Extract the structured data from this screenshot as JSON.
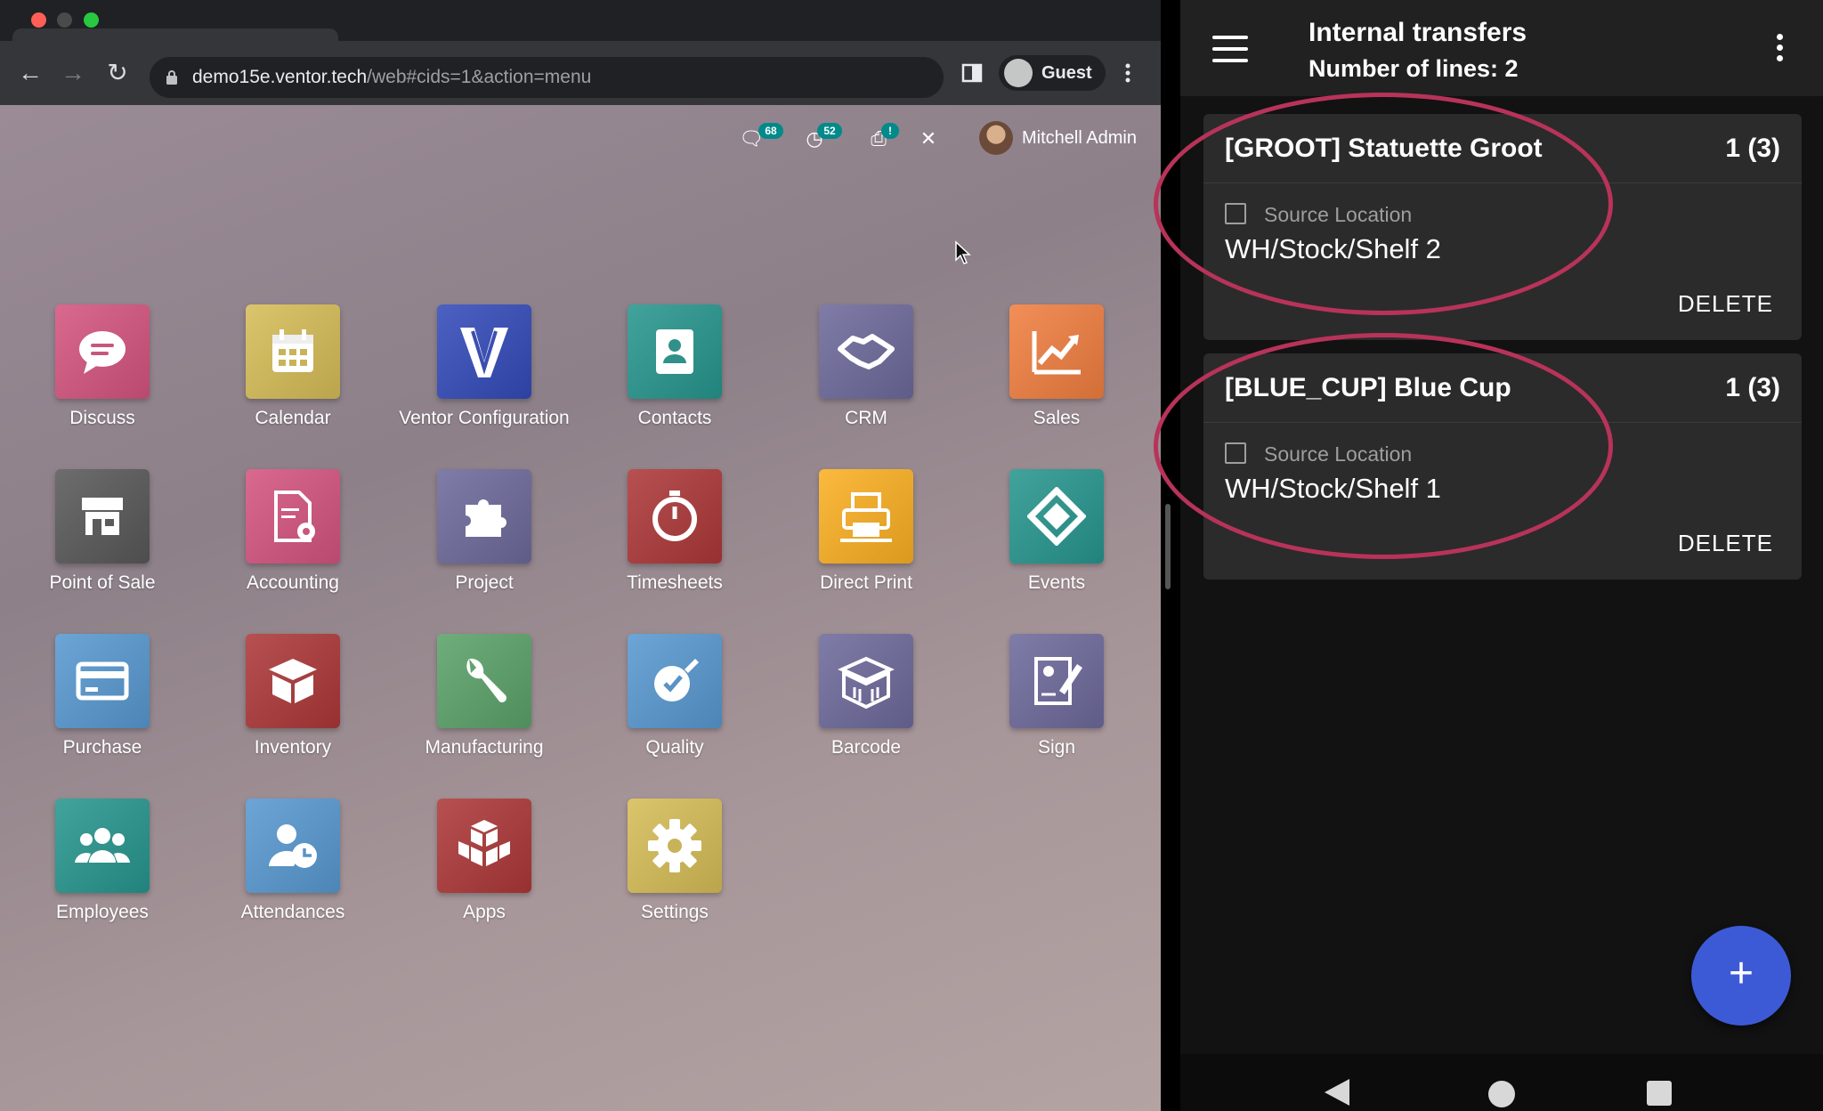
{
  "browser": {
    "url_host": "demo15e.ventor.tech",
    "url_path": "/web#cids=1&action=menu",
    "profile_label": "Guest"
  },
  "odoo": {
    "systray": {
      "messages_count": "68",
      "activities_count": "52",
      "print_badge": "!"
    },
    "user_name": "Mitchell Admin",
    "apps": [
      {
        "label": "Discuss",
        "icon": "chat-icon",
        "color": "#c7577c"
      },
      {
        "label": "Calendar",
        "icon": "calendar-icon",
        "color": "#c9b35a"
      },
      {
        "label": "Ventor Configuration",
        "icon": "ventor-logo-icon",
        "color": "#3b4fb0"
      },
      {
        "label": "Contacts",
        "icon": "contact-card-icon",
        "color": "#2f9189"
      },
      {
        "label": "CRM",
        "icon": "handshake-icon",
        "color": "#6e6a96"
      },
      {
        "label": "Sales",
        "icon": "trend-chart-icon",
        "color": "#e07c45"
      },
      {
        "label": "Point of Sale",
        "icon": "shop-icon",
        "color": "#5b5b5b"
      },
      {
        "label": "Accounting",
        "icon": "invoice-gear-icon",
        "color": "#c7577c"
      },
      {
        "label": "Project",
        "icon": "puzzle-icon",
        "color": "#6e6a96"
      },
      {
        "label": "Timesheets",
        "icon": "stopwatch-icon",
        "color": "#a53f3f"
      },
      {
        "label": "Direct Print",
        "icon": "printer-icon",
        "color": "#e9a72c"
      },
      {
        "label": "Events",
        "icon": "ticket-icon",
        "color": "#2f9189"
      },
      {
        "label": "Purchase",
        "icon": "credit-card-icon",
        "color": "#5a93c4"
      },
      {
        "label": "Inventory",
        "icon": "box-icon",
        "color": "#a53f3f"
      },
      {
        "label": "Manufacturing",
        "icon": "wrench-icon",
        "color": "#5d9c6a"
      },
      {
        "label": "Quality",
        "icon": "quality-badge-icon",
        "color": "#5a93c4"
      },
      {
        "label": "Barcode",
        "icon": "barcode-box-icon",
        "color": "#6e6a96"
      },
      {
        "label": "Sign",
        "icon": "sign-document-icon",
        "color": "#6e6a96"
      },
      {
        "label": "Employees",
        "icon": "people-icon",
        "color": "#2f9189"
      },
      {
        "label": "Attendances",
        "icon": "user-clock-icon",
        "color": "#5a93c4"
      },
      {
        "label": "Apps",
        "icon": "cubes-icon",
        "color": "#a53f3f"
      },
      {
        "label": "Settings",
        "icon": "gear-icon",
        "color": "#c9b35a"
      }
    ]
  },
  "mobile": {
    "title": "Internal transfers",
    "subtitle": "Number of lines: 2",
    "lines": [
      {
        "product": "[GROOT] Statuette Groot",
        "qty": "1 (3)",
        "location_label": "Source Location",
        "location": "WH/Stock/Shelf 2",
        "action": "DELETE"
      },
      {
        "product": "[BLUE_CUP] Blue Cup",
        "qty": "1 (3)",
        "location_label": "Source Location",
        "location": "WH/Stock/Shelf 1",
        "action": "DELETE"
      }
    ],
    "fab_label": "+",
    "annotation_color": "#b8335a",
    "fab_color": "#3d5ad6"
  }
}
